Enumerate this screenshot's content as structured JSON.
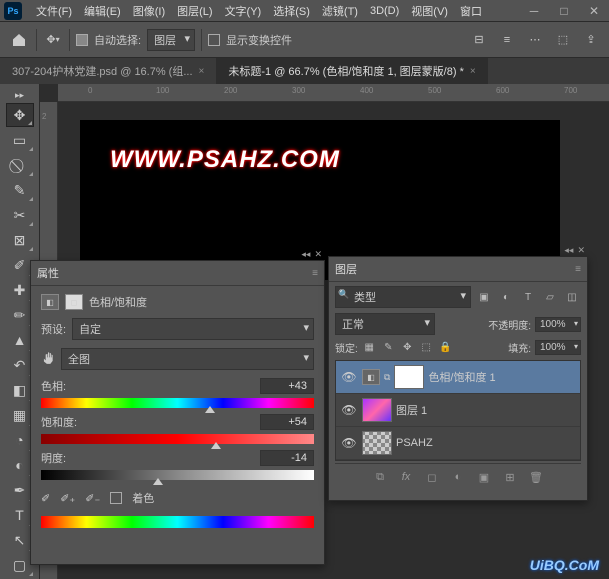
{
  "menu": {
    "file": "文件(F)",
    "edit": "编辑(E)",
    "image": "图像(I)",
    "layer": "图层(L)",
    "type": "文字(Y)",
    "select": "选择(S)",
    "filter": "滤镜(T)",
    "threed": "3D(D)",
    "view": "视图(V)",
    "window": "窗口"
  },
  "toolbar": {
    "autoselect": "自动选择:",
    "autoselect_target": "图层",
    "showtransform": "显示变换控件"
  },
  "tabs": {
    "inactive": "307-204护林党建.psd @ 16.7% (组...",
    "active": "未标题-1 @ 66.7% (色相/饱和度 1, 图层蒙版/8) *"
  },
  "ruler_h": [
    "0",
    "100",
    "200",
    "300",
    "400",
    "500",
    "600",
    "700"
  ],
  "ruler_v": [
    "2"
  ],
  "canvas": {
    "watermark": "WWW.PSAHZ.COM"
  },
  "props": {
    "title": "属性",
    "adj_name": "色相/饱和度",
    "preset_label": "预设:",
    "preset_value": "自定",
    "range_value": "全图",
    "hue_label": "色相:",
    "hue_value": "+43",
    "sat_label": "饱和度:",
    "sat_value": "+54",
    "light_label": "明度:",
    "light_value": "-14",
    "colorize": "着色"
  },
  "layers": {
    "title": "图层",
    "filter_type": "类型",
    "blend": "正常",
    "opacity_label": "不透明度:",
    "opacity_value": "100%",
    "lock_label": "锁定:",
    "fill_label": "填充:",
    "fill_value": "100%",
    "items": [
      {
        "name": "色相/饱和度 1"
      },
      {
        "name": "图层 1"
      },
      {
        "name": "PSAHZ"
      }
    ]
  },
  "footer": {
    "watermark": "UiBQ.CoM"
  }
}
